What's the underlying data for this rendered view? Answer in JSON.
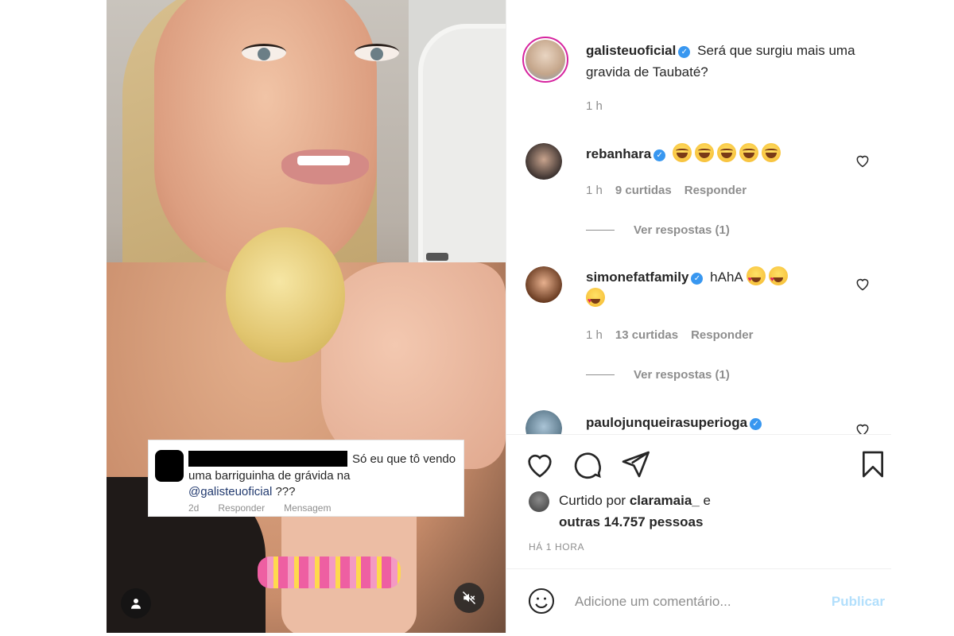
{
  "post": {
    "author": "galisteuoficial",
    "caption": "Será que surgiu mais uma gravida de Taubaté?",
    "age": "1 h"
  },
  "comments": [
    {
      "user": "rebanhara",
      "emojis": [
        "joy",
        "joy",
        "joy",
        "joy",
        "joy"
      ],
      "age": "1 h",
      "likes": "9 curtidas",
      "reply_label": "Responder",
      "view_replies": "Ver respostas (1)"
    },
    {
      "user": "simonefatfamily",
      "text": "hAhA",
      "emojis": [
        "heart-eyes",
        "heart-eyes",
        "heart-eyes"
      ],
      "age": "1 h",
      "likes": "13 curtidas",
      "reply_label": "Responder",
      "view_replies": "Ver respostas (1)"
    },
    {
      "user": "paulojunqueirasuperioga"
    }
  ],
  "overlay_comment": {
    "line1": "Só eu que tô vendo",
    "line2": "uma barriguinha de grávida na",
    "mention": "@galisteuoficial",
    "after_mention": " ???",
    "age": "2d",
    "reply": "Responder",
    "message": "Mensagem"
  },
  "likes": {
    "prefix": "Curtido por ",
    "user": "claramaia_",
    "conj": " e",
    "others": "outras 14.757 pessoas"
  },
  "timestamp": "HÁ 1 HORA",
  "composer": {
    "placeholder": "Adicione um comentário...",
    "publish": "Publicar"
  },
  "icons": [
    "heart-icon",
    "comment-icon",
    "share-icon",
    "bookmark-icon",
    "smile-icon",
    "mute-icon",
    "user-icon",
    "verified-icon"
  ],
  "colors": {
    "verified": "#3897f0",
    "publish": "#b2dffc",
    "meta": "#8e8e8e",
    "text": "#262626"
  }
}
